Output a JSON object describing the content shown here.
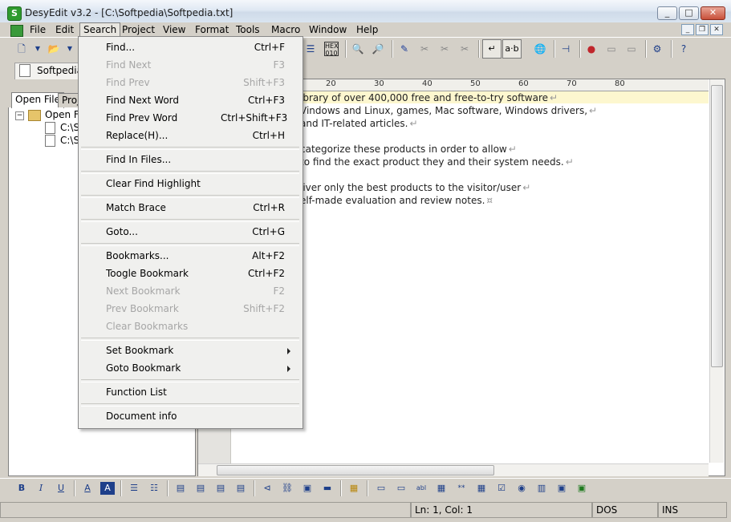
{
  "window": {
    "title": "DesyEdit v3.2 - [C:\\Softpedia\\Softpedia.txt]",
    "app_icon_text": "S"
  },
  "menubar": {
    "items": [
      "File",
      "Edit",
      "Search",
      "Project",
      "View",
      "Format",
      "Tools",
      "Macro",
      "Window",
      "Help"
    ]
  },
  "document_tab": {
    "label": "Softpedia.c"
  },
  "left_panel": {
    "tabs": [
      "Open File",
      "Proje"
    ],
    "tree": [
      "Open File",
      "C:\\S",
      "C:\\S"
    ]
  },
  "editor": {
    "ruler_numbers": [
      "20",
      "30",
      "40",
      "50",
      "60",
      "70",
      "80"
    ],
    "lines": [
      "ibrary of over 400,000 free and free-to-try software",
      "Vindows and Linux, games, Mac software, Windows drivers,",
      "and IT-related articles.",
      "",
      "categorize these products in order to allow",
      "to find the exact product they and their system needs.",
      "",
      "liver only the best products to the visitor/user",
      "elf-made evaluation and review notes."
    ]
  },
  "search_menu": {
    "items": [
      {
        "label": "Find...",
        "shortcut": "Ctrl+F",
        "disabled": false
      },
      {
        "label": "Find Next",
        "shortcut": "F3",
        "disabled": true
      },
      {
        "label": "Find Prev",
        "shortcut": "Shift+F3",
        "disabled": true
      },
      {
        "label": "Find Next Word",
        "shortcut": "Ctrl+F3",
        "disabled": false
      },
      {
        "label": "Find Prev Word",
        "shortcut": "Ctrl+Shift+F3",
        "disabled": false
      },
      {
        "label": "Replace(H)...",
        "shortcut": "Ctrl+H",
        "disabled": false
      },
      {
        "label": "Find In Files...",
        "shortcut": "",
        "disabled": false
      },
      {
        "label": "Clear Find Highlight",
        "shortcut": "",
        "disabled": false
      },
      {
        "label": "Match Brace",
        "shortcut": "Ctrl+R",
        "disabled": false
      },
      {
        "label": "Goto...",
        "shortcut": "Ctrl+G",
        "disabled": false
      },
      {
        "label": "Bookmarks...",
        "shortcut": "Alt+F2",
        "disabled": false
      },
      {
        "label": "Toogle Bookmark",
        "shortcut": "Ctrl+F2",
        "disabled": false
      },
      {
        "label": "Next Bookmark",
        "shortcut": "F2",
        "disabled": true
      },
      {
        "label": "Prev Bookmark",
        "shortcut": "Shift+F2",
        "disabled": true
      },
      {
        "label": "Clear Bookmarks",
        "shortcut": "",
        "disabled": true
      },
      {
        "label": "Set Bookmark",
        "shortcut": "",
        "disabled": false
      },
      {
        "label": "Goto Bookmark",
        "shortcut": "",
        "disabled": false
      },
      {
        "label": "Function List",
        "shortcut": "",
        "disabled": false
      },
      {
        "label": "Document info",
        "shortcut": "",
        "disabled": false
      }
    ]
  },
  "statusbar": {
    "position": "Ln: 1, Col: 1",
    "line_ending": "DOS",
    "mode": "INS"
  },
  "colors": {
    "current_line": "#fdf7cf",
    "menu_bg": "#f0f0ee",
    "disabled_text": "#a6a6a6"
  }
}
